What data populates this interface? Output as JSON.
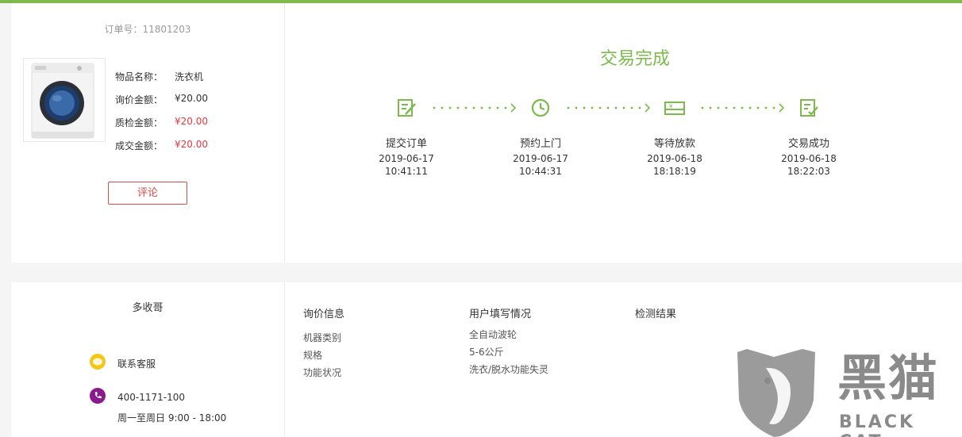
{
  "order": {
    "number_label": "订单号：11801203",
    "item_name_label": "物品名称：",
    "item_name_value": "洗衣机",
    "inquiry_price_label": "询价金额：",
    "inquiry_price_value": "¥20.00",
    "inspection_price_label": "质检金额：",
    "inspection_price_value": "¥20.00",
    "deal_price_label": "成交金额：",
    "deal_price_value": "¥20.00",
    "review_button": "评论"
  },
  "status": {
    "title": "交易完成",
    "steps": [
      {
        "label": "提交订单",
        "date": "2019-06-17",
        "time": "10:41:11",
        "icon": "form-edit-icon"
      },
      {
        "label": "预约上门",
        "date": "2019-06-17",
        "time": "10:44:31",
        "icon": "clock-icon"
      },
      {
        "label": "等待放款",
        "date": "2019-06-18",
        "time": "18:18:19",
        "icon": "payment-card-icon"
      },
      {
        "label": "交易成功",
        "date": "2019-06-18",
        "time": "18:22:03",
        "icon": "form-check-icon"
      }
    ]
  },
  "shop": {
    "name": "多收哥",
    "customer_service": "联系客服",
    "phone": "400-1171-100",
    "hours": "周一至周日 9:00 - 18:00"
  },
  "details": {
    "inquiry": {
      "title": "询价信息",
      "items": [
        "机器类别",
        "规格",
        "功能状况"
      ]
    },
    "user_input": {
      "title": "用户填写情况",
      "items": [
        "全自动波轮",
        "5-6公斤",
        "洗衣/脱水功能失灵"
      ]
    },
    "inspection": {
      "title": "检测结果"
    }
  },
  "watermark": {
    "cn": "黑猫",
    "en": "BLACK CAT"
  },
  "colors": {
    "accent_green": "#7cbb4b",
    "price_red": "#e8383d",
    "service_yellow": "#f5c518",
    "phone_purple": "#8b1a8f"
  }
}
